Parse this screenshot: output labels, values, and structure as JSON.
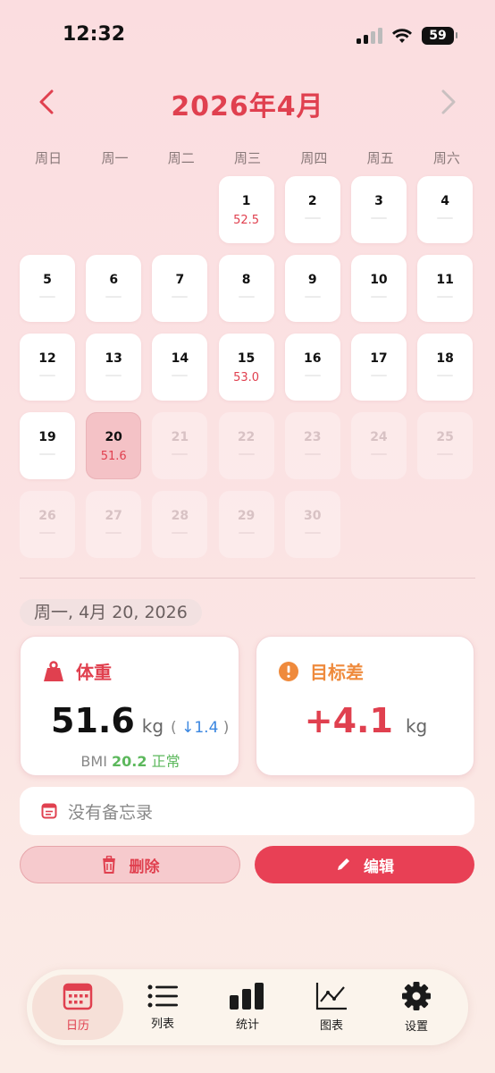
{
  "status": {
    "time": "12:32",
    "battery": "59"
  },
  "header": {
    "title": "2026年4月"
  },
  "weekdays": [
    "周日",
    "周一",
    "周二",
    "周三",
    "周四",
    "周五",
    "周六"
  ],
  "days": [
    {
      "d": "",
      "state": "empty"
    },
    {
      "d": "",
      "state": "empty"
    },
    {
      "d": "",
      "state": "empty"
    },
    {
      "d": "1",
      "w": "52.5"
    },
    {
      "d": "2"
    },
    {
      "d": "3"
    },
    {
      "d": "4"
    },
    {
      "d": "5"
    },
    {
      "d": "6"
    },
    {
      "d": "7"
    },
    {
      "d": "8"
    },
    {
      "d": "9"
    },
    {
      "d": "10"
    },
    {
      "d": "11"
    },
    {
      "d": "12"
    },
    {
      "d": "13"
    },
    {
      "d": "14"
    },
    {
      "d": "15",
      "w": "53.0"
    },
    {
      "d": "16"
    },
    {
      "d": "17"
    },
    {
      "d": "18"
    },
    {
      "d": "19"
    },
    {
      "d": "20",
      "w": "51.6",
      "state": "selected"
    },
    {
      "d": "21",
      "state": "future"
    },
    {
      "d": "22",
      "state": "future"
    },
    {
      "d": "23",
      "state": "future"
    },
    {
      "d": "24",
      "state": "future"
    },
    {
      "d": "25",
      "state": "future"
    },
    {
      "d": "26",
      "state": "future"
    },
    {
      "d": "27",
      "state": "future"
    },
    {
      "d": "28",
      "state": "future"
    },
    {
      "d": "29",
      "state": "future"
    },
    {
      "d": "30",
      "state": "future"
    }
  ],
  "selected_date": "周一, 4月 20, 2026",
  "weight_card": {
    "label": "体重",
    "value": "51.6",
    "unit": "kg",
    "delta_open": "(",
    "delta_arrow": "↓",
    "delta_value": "1.4",
    "delta_close": ")",
    "bmi_label": "BMI",
    "bmi_value": "20.2",
    "bmi_status": "正常"
  },
  "goal_card": {
    "label": "目标差",
    "value": "+4.1",
    "unit": "kg"
  },
  "memo": {
    "text": "没有备忘录"
  },
  "actions": {
    "delete_label": "删除",
    "edit_label": "编辑"
  },
  "tabs": [
    {
      "label": "日历",
      "icon": "calendar-icon",
      "active": true
    },
    {
      "label": "列表",
      "icon": "list-icon"
    },
    {
      "label": "统计",
      "icon": "bar-chart-icon"
    },
    {
      "label": "图表",
      "icon": "line-chart-icon"
    },
    {
      "label": "设置",
      "icon": "gear-icon"
    }
  ],
  "colors": {
    "accent": "#e0404f",
    "orange": "#ef8a3c",
    "green": "#5cb85c",
    "blue": "#3a86e0"
  }
}
